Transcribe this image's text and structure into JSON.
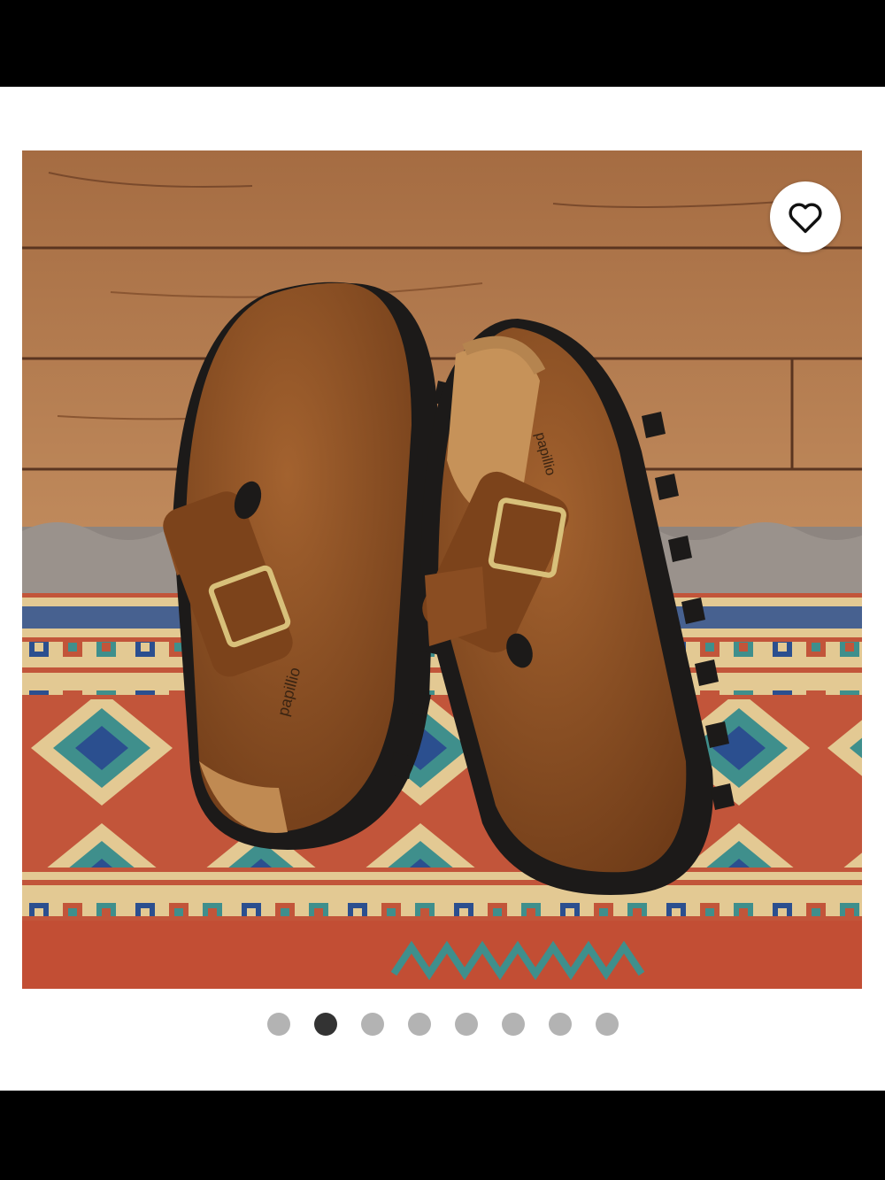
{
  "product_image": {
    "alt": "",
    "imprint_text": "papillio",
    "colors": {
      "suede": "#8a4d22",
      "sole": "#1c1a19",
      "floor": "#b27a4d",
      "rug_red": "#c2553a",
      "rug_blue": "#2b4f8f",
      "rug_teal": "#3f8f8c",
      "rug_cream": "#e3c993"
    }
  },
  "favorite_button": {
    "icon": "heart-outline-icon"
  },
  "carousel": {
    "count": 8,
    "active_index": 1
  }
}
